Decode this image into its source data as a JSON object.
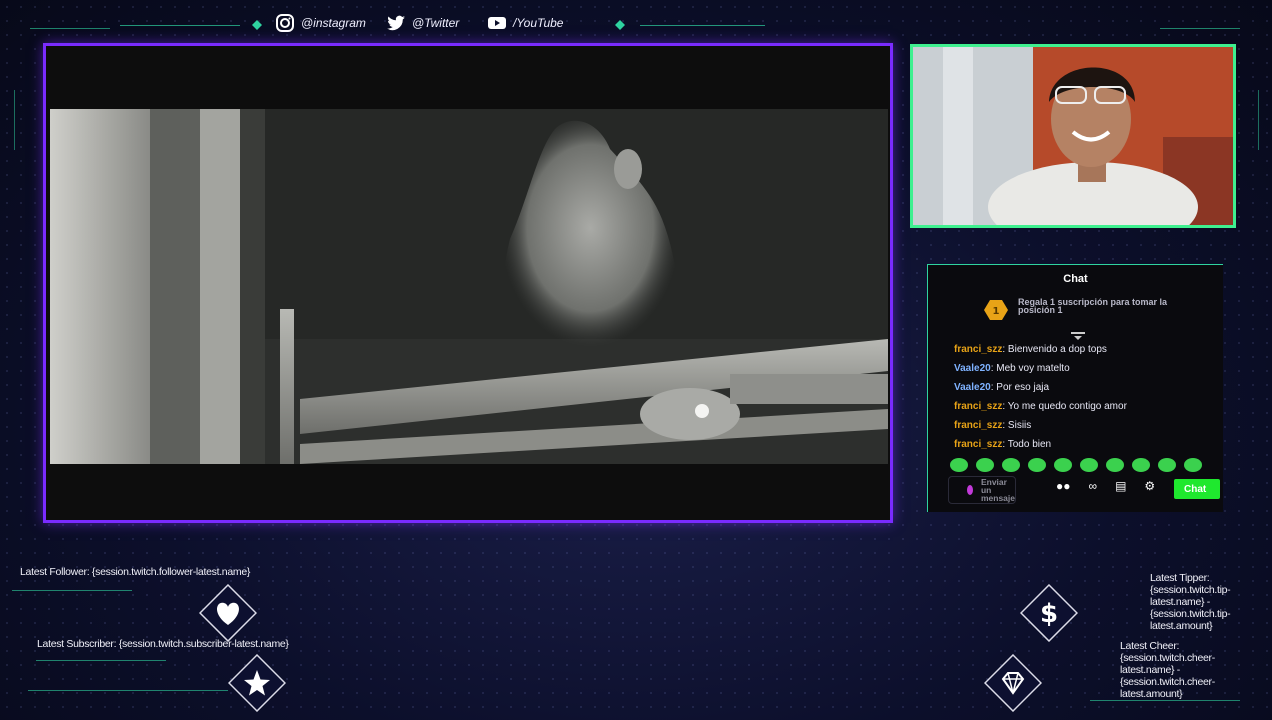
{
  "social": {
    "instagram": "@instagram",
    "twitter": "@Twitter",
    "youtube": "/YouTube"
  },
  "chat": {
    "title": "Chat",
    "promo_rank": "1",
    "promo_text": "Regala 1 suscripción para tomar la posición 1",
    "messages": [
      {
        "user": "franci_szz",
        "text": "Bienvenido a dop tops",
        "color": "#e8a317"
      },
      {
        "user": "Vaale20",
        "text": "Meb voy matelto",
        "color": "#7fb2ff"
      },
      {
        "user": "Vaale20",
        "text": "Por eso jaja",
        "color": "#7fb2ff"
      },
      {
        "user": "franci_szz",
        "text": "Yo me quedo contigo amor",
        "color": "#e8a317"
      },
      {
        "user": "franci_szz",
        "text": "Sisiis",
        "color": "#e8a317"
      },
      {
        "user": "franci_szz",
        "text": "Todo bien",
        "color": "#e8a317"
      }
    ],
    "emote_count": 10,
    "placeholder": "Enviar un mensaje",
    "send_label": "Chat"
  },
  "widgets": {
    "latest_follower": "Latest Follower: {session.twitch.follower-latest.name}",
    "latest_subscriber": "Latest Subscriber: {session.twitch.subscriber-latest.name}",
    "latest_tipper": "Latest Tipper: {session.twitch.tip-latest.name} - {session.twitch.tip-latest.amount}",
    "latest_cheer": "Latest Cheer: {session.twitch.cheer-latest.name} - {session.twitch.cheer-latest.amount}"
  },
  "colors": {
    "video_border": "#7a2bff",
    "webcam_border": "#3ef08f",
    "accent_line": "#2fd3a0"
  }
}
